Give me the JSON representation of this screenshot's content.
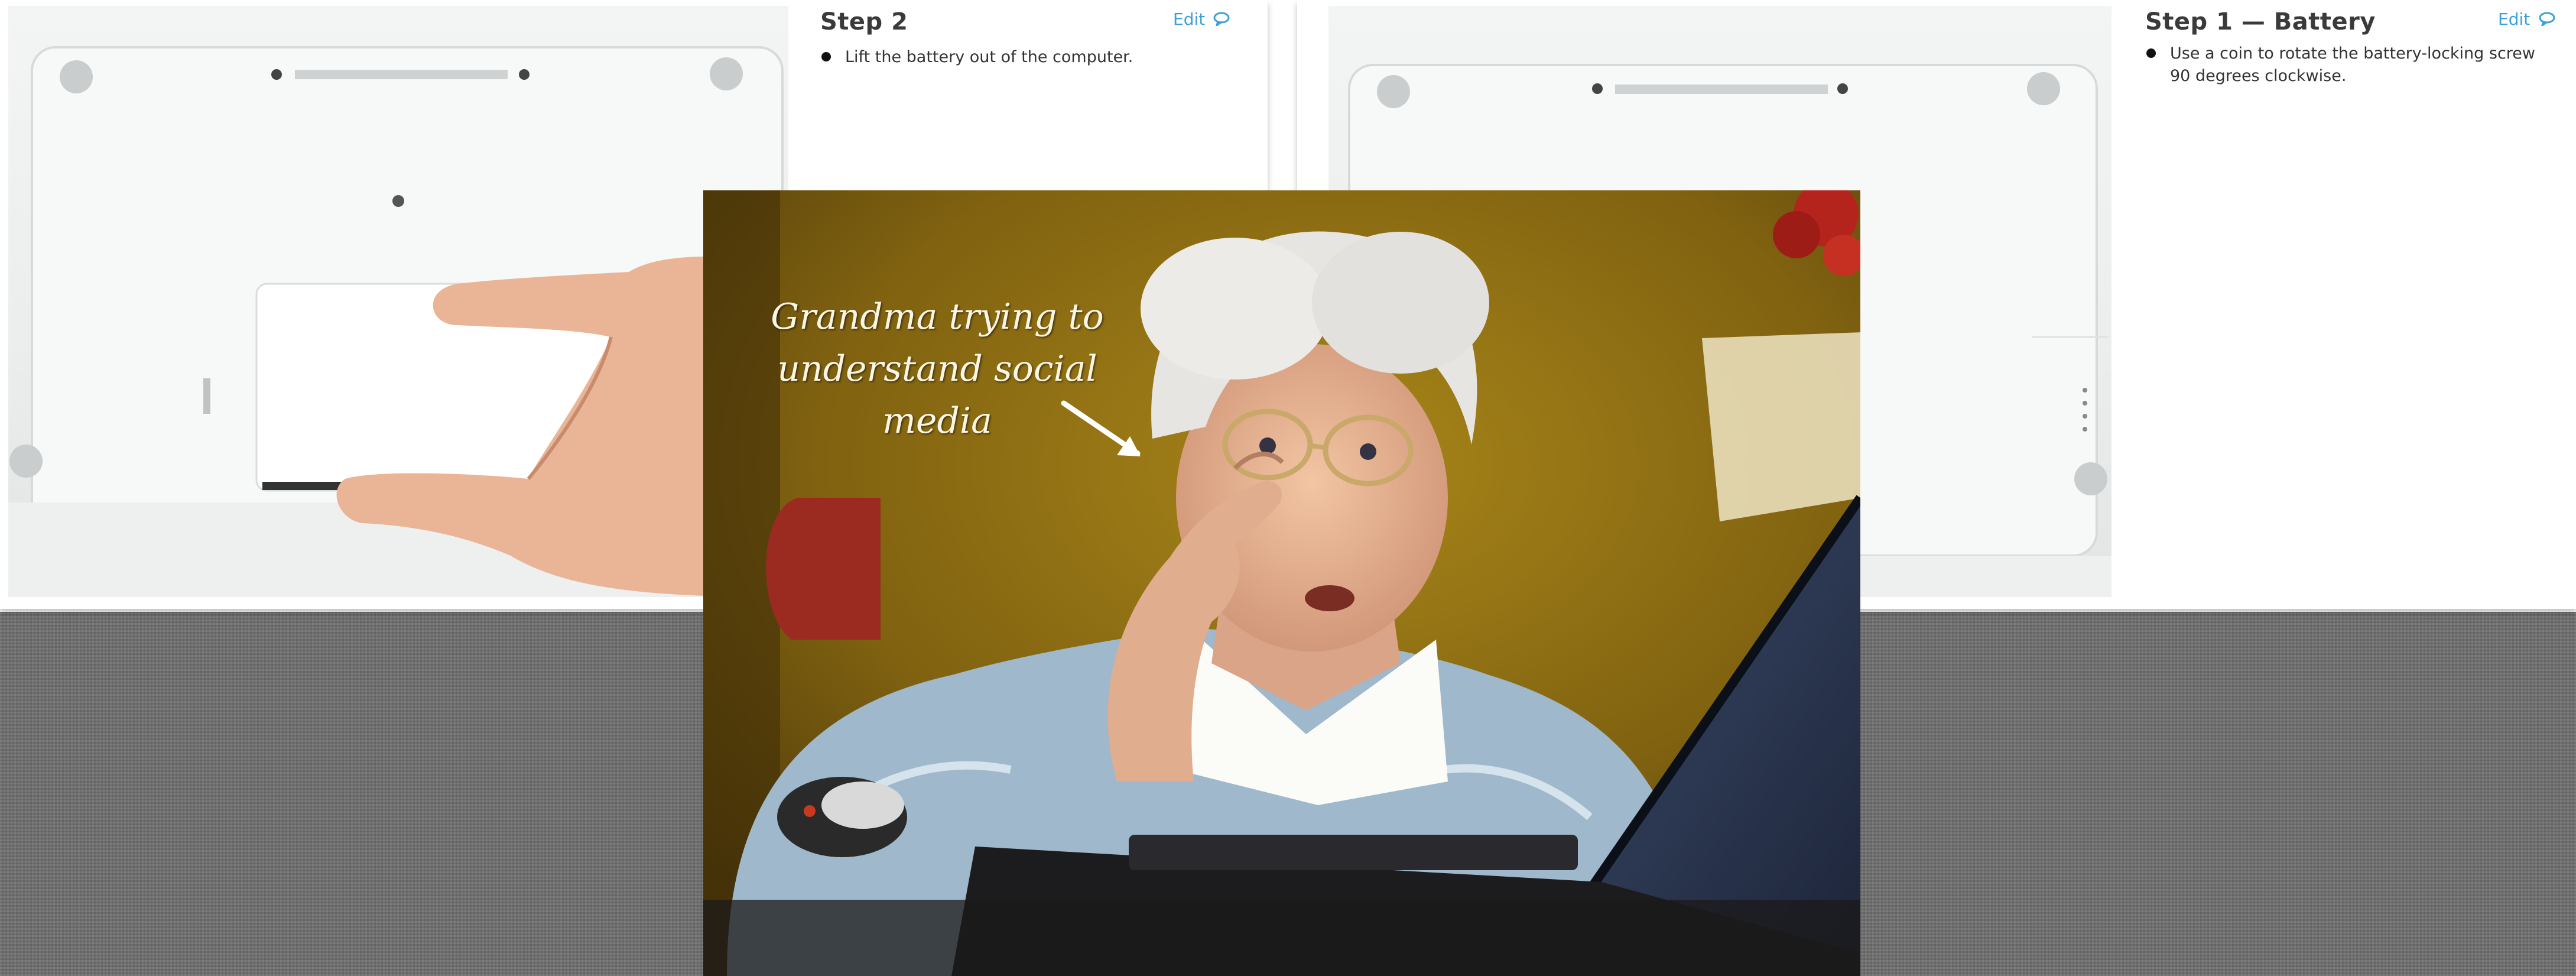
{
  "left_card": {
    "step_title": "Step 2",
    "edit_label": "Edit",
    "bullets": [
      "Lift the battery out of the computer."
    ]
  },
  "right_card": {
    "step_title": "Step 1 — Battery",
    "edit_label": "Edit",
    "bullets": [
      "Use a coin to rotate the battery-locking screw 90 degrees clockwise."
    ]
  },
  "meme": {
    "caption": "Grandma trying to understand social media"
  },
  "colors": {
    "edit_link": "#3aa0d8",
    "background": "#6f6f6f",
    "meme_wall": "#8a6c12"
  },
  "icons": [
    "comment-icon",
    "bullet-icon",
    "arrow-icon"
  ]
}
